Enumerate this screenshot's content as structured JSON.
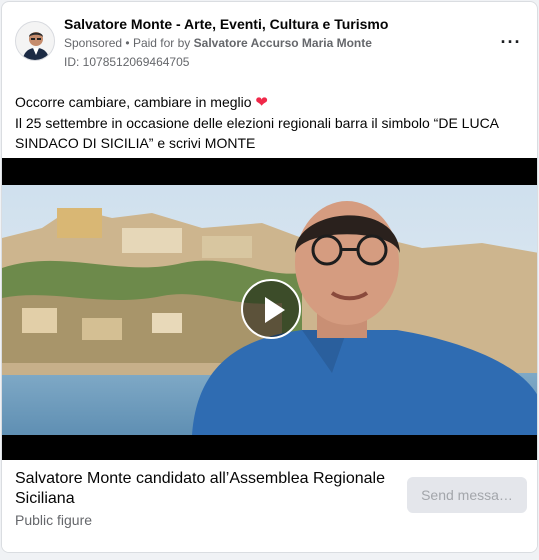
{
  "ad": {
    "page_name": "Salvatore Monte - Arte, Eventi, Cultura e Turismo",
    "sponsored_label": "Sponsored",
    "separator": "•",
    "paid_for_prefix": "Paid for by",
    "paid_for_name": "Salvatore Accurso Maria Monte",
    "id_label": "ID: 1078512069464705",
    "more_label": "···",
    "body_line1": "Occorre cambiare, cambiare in meglio",
    "body_heart": "❤",
    "body_line2": "Il 25 settembre in occasione delle elezioni regionali barra il simbolo “DE LUCA SINDACO DI SICILIA” e scrivi MONTE"
  },
  "cta": {
    "title": "Salvatore Monte candidato all’Assemblea Regionale Siciliana",
    "subtitle": "Public figure",
    "button_label": "Send messa…"
  },
  "colors": {
    "secondary_text": "#65676b",
    "heart": "#f02849",
    "button_bg": "#e4e6eb",
    "button_text": "#a3a6ab"
  }
}
